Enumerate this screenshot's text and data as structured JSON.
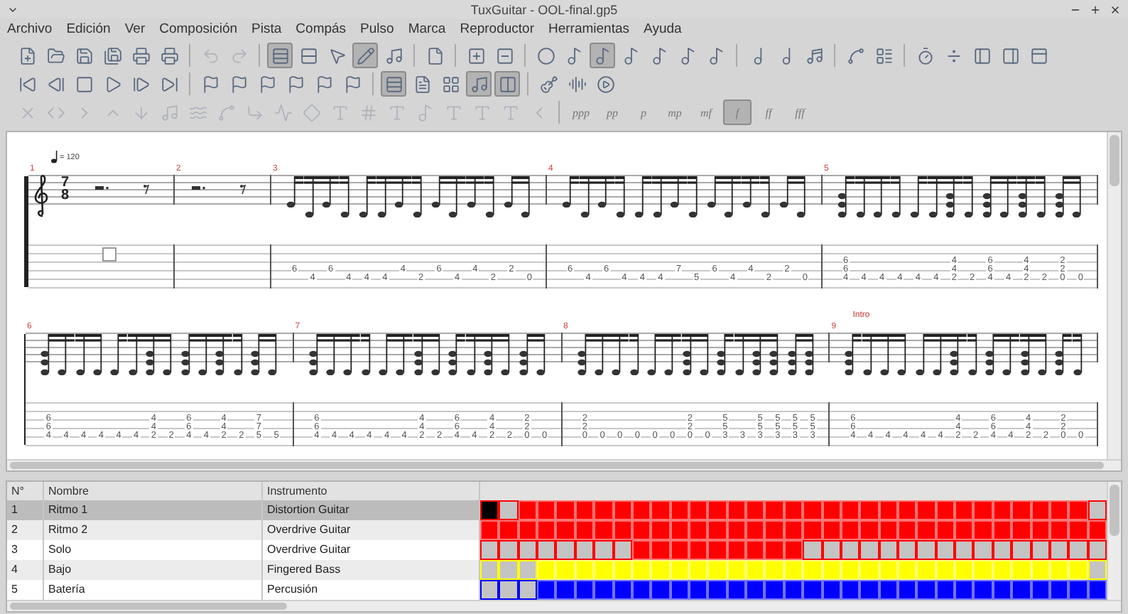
{
  "window": {
    "title": "TuxGuitar - OOL-final.gp5"
  },
  "menu": [
    "Archivo",
    "Edición",
    "Ver",
    "Composición",
    "Pista",
    "Compás",
    "Pulso",
    "Marca",
    "Reproductor",
    "Herramientas",
    "Ayuda"
  ],
  "toolbars": [
    [
      {
        "kind": "button",
        "pressed": false,
        "disabled": false
      },
      {
        "kind": "button",
        "pressed": false,
        "disabled": false
      },
      {
        "kind": "button",
        "pressed": false,
        "disabled": false
      },
      {
        "kind": "button",
        "pressed": false,
        "disabled": false
      },
      {
        "kind": "button",
        "pressed": false,
        "disabled": false
      },
      {
        "kind": "button",
        "pressed": false,
        "disabled": false
      },
      {
        "kind": "separator"
      },
      {
        "kind": "button",
        "pressed": false,
        "disabled": true
      },
      {
        "kind": "button",
        "pressed": false,
        "disabled": true
      },
      {
        "kind": "separator"
      },
      {
        "kind": "button",
        "pressed": true,
        "disabled": false
      },
      {
        "kind": "button",
        "pressed": false,
        "disabled": false
      },
      {
        "kind": "button",
        "pressed": false,
        "disabled": false
      },
      {
        "kind": "button",
        "pressed": true,
        "disabled": false
      },
      {
        "kind": "button",
        "pressed": false,
        "disabled": false
      },
      {
        "kind": "separator"
      },
      {
        "kind": "button",
        "pressed": false,
        "disabled": false
      },
      {
        "kind": "separator"
      },
      {
        "kind": "button",
        "pressed": false,
        "disabled": false
      },
      {
        "kind": "button",
        "pressed": false,
        "disabled": false
      },
      {
        "kind": "separator"
      },
      {
        "kind": "button",
        "pressed": false,
        "disabled": false
      },
      {
        "kind": "button",
        "pressed": false,
        "disabled": false
      },
      {
        "kind": "button",
        "pressed": true,
        "disabled": false
      },
      {
        "kind": "button",
        "pressed": false,
        "disabled": false
      },
      {
        "kind": "button",
        "pressed": false,
        "disabled": false
      },
      {
        "kind": "button",
        "pressed": false,
        "disabled": false
      },
      {
        "kind": "button",
        "pressed": false,
        "disabled": false
      },
      {
        "kind": "separator"
      },
      {
        "kind": "button",
        "pressed": false,
        "disabled": false
      },
      {
        "kind": "button",
        "pressed": false,
        "disabled": false
      },
      {
        "kind": "button",
        "pressed": false,
        "disabled": false
      },
      {
        "kind": "separator"
      },
      {
        "kind": "button",
        "pressed": false,
        "disabled": false
      },
      {
        "kind": "button",
        "pressed": false,
        "disabled": false
      },
      {
        "kind": "separator"
      },
      {
        "kind": "button",
        "pressed": false,
        "disabled": false
      },
      {
        "kind": "button",
        "pressed": false,
        "disabled": false
      },
      {
        "kind": "button",
        "pressed": false,
        "disabled": false
      },
      {
        "kind": "button",
        "pressed": false,
        "disabled": false
      },
      {
        "kind": "button",
        "pressed": false,
        "disabled": false
      }
    ],
    [
      {
        "kind": "button",
        "pressed": false,
        "disabled": false
      },
      {
        "kind": "button",
        "pressed": false,
        "disabled": false
      },
      {
        "kind": "button",
        "pressed": false,
        "disabled": false
      },
      {
        "kind": "button",
        "pressed": false,
        "disabled": false
      },
      {
        "kind": "button",
        "pressed": false,
        "disabled": false
      },
      {
        "kind": "button",
        "pressed": false,
        "disabled": false
      },
      {
        "kind": "separator"
      },
      {
        "kind": "button",
        "pressed": false,
        "disabled": false
      },
      {
        "kind": "button",
        "pressed": false,
        "disabled": false
      },
      {
        "kind": "button",
        "pressed": false,
        "disabled": false
      },
      {
        "kind": "button",
        "pressed": false,
        "disabled": false
      },
      {
        "kind": "button",
        "pressed": false,
        "disabled": false
      },
      {
        "kind": "button",
        "pressed": false,
        "disabled": false
      },
      {
        "kind": "separator"
      },
      {
        "kind": "button",
        "pressed": true,
        "disabled": false
      },
      {
        "kind": "button",
        "pressed": false,
        "disabled": false
      },
      {
        "kind": "button",
        "pressed": false,
        "disabled": false
      },
      {
        "kind": "button",
        "pressed": true,
        "disabled": false
      },
      {
        "kind": "button",
        "pressed": true,
        "disabled": false
      },
      {
        "kind": "separator"
      },
      {
        "kind": "button",
        "pressed": false,
        "disabled": false
      },
      {
        "kind": "button",
        "pressed": false,
        "disabled": false
      },
      {
        "kind": "button",
        "pressed": false,
        "disabled": false
      }
    ],
    [
      {
        "kind": "button",
        "pressed": false,
        "disabled": true
      },
      {
        "kind": "button",
        "pressed": false,
        "disabled": true
      },
      {
        "kind": "button",
        "pressed": false,
        "disabled": true
      },
      {
        "kind": "button",
        "pressed": false,
        "disabled": true
      },
      {
        "kind": "button",
        "pressed": false,
        "disabled": true
      },
      {
        "kind": "button",
        "pressed": false,
        "disabled": true
      },
      {
        "kind": "button",
        "pressed": false,
        "disabled": true
      },
      {
        "kind": "button",
        "pressed": false,
        "disabled": true
      },
      {
        "kind": "button",
        "pressed": false,
        "disabled": true
      },
      {
        "kind": "button",
        "pressed": false,
        "disabled": true
      },
      {
        "kind": "button",
        "pressed": false,
        "disabled": true
      },
      {
        "kind": "button",
        "pressed": false,
        "disabled": true
      },
      {
        "kind": "button",
        "pressed": false,
        "disabled": true
      },
      {
        "kind": "button",
        "pressed": false,
        "disabled": true
      },
      {
        "kind": "button",
        "pressed": false,
        "disabled": true
      },
      {
        "kind": "button",
        "pressed": false,
        "disabled": true
      },
      {
        "kind": "button",
        "pressed": false,
        "disabled": true
      },
      {
        "kind": "button",
        "pressed": false,
        "disabled": true
      },
      {
        "kind": "button",
        "pressed": false,
        "disabled": true
      },
      {
        "kind": "separator"
      },
      {
        "kind": "dynamic",
        "label": "ppp",
        "pressed": false
      },
      {
        "kind": "dynamic",
        "label": "pp",
        "pressed": false
      },
      {
        "kind": "dynamic",
        "label": "p",
        "pressed": false
      },
      {
        "kind": "dynamic",
        "label": "mp",
        "pressed": false
      },
      {
        "kind": "dynamic",
        "label": "mf",
        "pressed": false
      },
      {
        "kind": "dynamic",
        "label": "f",
        "pressed": true
      },
      {
        "kind": "dynamic",
        "label": "ff",
        "pressed": false
      },
      {
        "kind": "dynamic",
        "label": "fff",
        "pressed": false
      }
    ]
  ],
  "score": {
    "systems": [
      {
        "measures": [
          {
            "number": "1",
            "clef": true,
            "time_signature": {
              "numerator": "7",
              "denominator": "8"
            },
            "tempo": "= 120",
            "cursor": true
          },
          {
            "number": "2"
          },
          {
            "number": "3",
            "beats": [
              {
                "string_4": "6"
              },
              {
                "string_5": "4"
              },
              {
                "string_4": "6"
              },
              {
                "string_5": "4"
              },
              {
                "string_5": "4"
              },
              {
                "string_5": "4"
              },
              {
                "string_4": "4"
              },
              {
                "string_5": "2"
              },
              {
                "string_4": "6"
              },
              {
                "string_5": "4"
              },
              {
                "string_4": "4"
              },
              {
                "string_5": "2"
              },
              {
                "string_4": "2"
              },
              {
                "string_5": "0"
              }
            ]
          },
          {
            "number": "4",
            "beats": [
              {
                "string_4": "6"
              },
              {
                "string_5": "4"
              },
              {
                "string_4": "6"
              },
              {
                "string_5": "4"
              },
              {
                "string_5": "4"
              },
              {
                "string_5": "4"
              },
              {
                "string_4": "7"
              },
              {
                "string_5": "5"
              },
              {
                "string_4": "6"
              },
              {
                "string_5": "4"
              },
              {
                "string_4": "4"
              },
              {
                "string_5": "2"
              },
              {
                "string_4": "2"
              },
              {
                "string_5": "0"
              }
            ]
          },
          {
            "number": "5",
            "beats": [
              {
                "string_3": "6",
                "string_4": "6",
                "string_5": "4"
              },
              {
                "string_5": "4"
              },
              {
                "string_5": "4"
              },
              {
                "string_5": "4"
              },
              {
                "string_5": "4"
              },
              {
                "string_5": "4"
              },
              {
                "string_3": "4",
                "string_4": "4",
                "string_5": "2"
              },
              {
                "string_5": "2"
              },
              {
                "string_3": "6",
                "string_4": "6",
                "string_5": "4"
              },
              {
                "string_5": "4"
              },
              {
                "string_3": "4",
                "string_4": "4",
                "string_5": "2"
              },
              {
                "string_5": "2"
              },
              {
                "string_3": "2",
                "string_4": "2",
                "string_5": "0"
              },
              {
                "string_5": "0"
              }
            ]
          }
        ]
      },
      {
        "measures": [
          {
            "number": "6",
            "beats": [
              {
                "string_3": "6",
                "string_4": "6",
                "string_5": "4"
              },
              {
                "string_5": "4"
              },
              {
                "string_5": "4"
              },
              {
                "string_5": "4"
              },
              {
                "string_5": "4"
              },
              {
                "string_5": "4"
              },
              {
                "string_3": "4",
                "string_4": "4",
                "string_5": "2"
              },
              {
                "string_5": "2"
              },
              {
                "string_3": "6",
                "string_4": "6",
                "string_5": "4"
              },
              {
                "string_5": "4"
              },
              {
                "string_3": "4",
                "string_4": "4",
                "string_5": "2"
              },
              {
                "string_5": "2"
              },
              {
                "string_3": "7",
                "string_4": "7",
                "string_5": "5"
              },
              {
                "string_5": "5"
              }
            ]
          },
          {
            "number": "7",
            "beats": [
              {
                "string_3": "6",
                "string_4": "6",
                "string_5": "4"
              },
              {
                "string_5": "4"
              },
              {
                "string_5": "4"
              },
              {
                "string_5": "4"
              },
              {
                "string_5": "4"
              },
              {
                "string_5": "4"
              },
              {
                "string_3": "4",
                "string_4": "4",
                "string_5": "2"
              },
              {
                "string_5": "2"
              },
              {
                "string_3": "6",
                "string_4": "6",
                "string_5": "4"
              },
              {
                "string_5": "4"
              },
              {
                "string_3": "4",
                "string_4": "4",
                "string_5": "2"
              },
              {
                "string_5": "2"
              },
              {
                "string_3": "2",
                "string_4": "2",
                "string_5": "0"
              },
              {
                "string_5": "0"
              }
            ]
          },
          {
            "number": "8",
            "beats": [
              {
                "string_3": "2",
                "string_4": "2",
                "string_5": "0"
              },
              {
                "string_5": "0"
              },
              {
                "string_5": "0"
              },
              {
                "string_5": "0"
              },
              {
                "string_5": "0"
              },
              {
                "string_5": "0"
              },
              {
                "string_3": "2",
                "string_4": "2",
                "string_5": "0"
              },
              {
                "string_5": "0"
              },
              {
                "string_3": "5",
                "string_4": "5",
                "string_5": "3"
              },
              {
                "string_5": "3"
              },
              {
                "string_3": "5",
                "string_4": "5",
                "string_5": "3"
              },
              {
                "string_3": "5",
                "string_4": "5",
                "string_5": "3"
              },
              {
                "string_3": "5",
                "string_4": "5",
                "string_5": "3"
              },
              {
                "string_3": "5",
                "string_4": "5",
                "string_5": "3"
              }
            ]
          },
          {
            "number": "9",
            "marker": "Intro",
            "beats": [
              {
                "string_3": "6",
                "string_4": "6",
                "string_5": "4"
              },
              {
                "string_5": "4"
              },
              {
                "string_5": "4"
              },
              {
                "string_5": "4"
              },
              {
                "string_5": "4"
              },
              {
                "string_5": "4"
              },
              {
                "string_3": "4",
                "string_4": "4",
                "string_5": "2"
              },
              {
                "string_5": "2"
              },
              {
                "string_3": "6",
                "string_4": "6",
                "string_5": "4"
              },
              {
                "string_5": "4"
              },
              {
                "string_3": "4",
                "string_4": "4",
                "string_5": "2"
              },
              {
                "string_5": "2"
              },
              {
                "string_3": "2",
                "string_4": "2",
                "string_5": "0"
              },
              {
                "string_5": "0"
              }
            ]
          }
        ]
      }
    ]
  },
  "track_table": {
    "columns": [
      "N°",
      "Nombre",
      "Instrumento"
    ],
    "tracks": [
      {
        "number": "1",
        "name": "Ritmo 1",
        "instrument": "Distortion Guitar",
        "selected": true,
        "cursor": true,
        "color": "#ff0000",
        "measures": [
          false,
          false,
          true,
          true,
          true,
          true,
          true,
          true,
          true,
          true,
          true,
          true,
          true,
          true,
          true,
          true,
          true,
          true,
          true,
          true,
          true,
          true,
          true,
          true,
          true,
          true,
          true,
          true,
          true,
          true,
          true,
          true,
          false
        ]
      },
      {
        "number": "2",
        "name": "Ritmo 2",
        "instrument": "Overdrive Guitar",
        "selected": false,
        "cursor": false,
        "color": "#ff0000",
        "measures": [
          true,
          true,
          true,
          true,
          true,
          true,
          true,
          true,
          true,
          true,
          true,
          true,
          true,
          true,
          true,
          true,
          true,
          true,
          true,
          true,
          true,
          true,
          true,
          true,
          true,
          true,
          true,
          true,
          true,
          true,
          true,
          true,
          true
        ]
      },
      {
        "number": "3",
        "name": "Solo",
        "instrument": "Overdrive Guitar",
        "selected": false,
        "cursor": false,
        "color": "#ff0000",
        "measures": [
          false,
          false,
          false,
          false,
          false,
          false,
          false,
          false,
          true,
          true,
          true,
          true,
          true,
          true,
          true,
          true,
          true,
          false,
          false,
          false,
          false,
          false,
          false,
          false,
          false,
          false,
          false,
          false,
          false,
          false,
          false,
          false,
          false
        ]
      },
      {
        "number": "4",
        "name": "Bajo",
        "instrument": "Fingered Bass",
        "selected": false,
        "cursor": false,
        "color": "#ffff00",
        "measures": [
          false,
          false,
          false,
          true,
          true,
          true,
          true,
          true,
          true,
          true,
          true,
          true,
          true,
          true,
          true,
          true,
          true,
          true,
          true,
          true,
          true,
          true,
          true,
          true,
          true,
          true,
          true,
          true,
          true,
          true,
          true,
          true,
          false
        ]
      },
      {
        "number": "5",
        "name": "Batería",
        "instrument": "Percusión",
        "selected": false,
        "cursor": false,
        "color": "#0000ff",
        "measures": [
          false,
          false,
          false,
          true,
          true,
          true,
          true,
          true,
          true,
          true,
          true,
          true,
          true,
          true,
          true,
          true,
          true,
          true,
          true,
          true,
          true,
          true,
          true,
          true,
          true,
          true,
          true,
          true,
          true,
          true,
          true,
          true,
          true
        ]
      }
    ]
  }
}
